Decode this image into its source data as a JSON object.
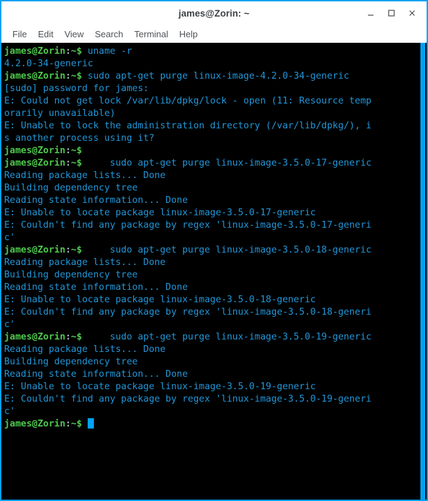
{
  "window": {
    "title": "james@Zorin: ~",
    "border_color": "#00a2f3",
    "buttons": {
      "minimize": "minimize",
      "maximize": "maximize",
      "close": "close"
    }
  },
  "menubar": {
    "items": [
      {
        "label": "File"
      },
      {
        "label": "Edit"
      },
      {
        "label": "View"
      },
      {
        "label": "Search"
      },
      {
        "label": "Terminal"
      },
      {
        "label": "Help"
      }
    ]
  },
  "terminal": {
    "background": "#000000",
    "prompt": {
      "user_host": "james@Zorin",
      "colon": ":",
      "path_sigil": "~$",
      "user_host_color": "#4ec94e",
      "text_color": "#2196d8"
    },
    "cursor": {
      "color": "#00a2f3",
      "shape": "block"
    },
    "lines": [
      {
        "type": "prompt",
        "text": " uname -r"
      },
      {
        "type": "output",
        "text": "4.2.0-34-generic"
      },
      {
        "type": "prompt",
        "text": " sudo apt-get purge linux-image-4.2.0-34-generic"
      },
      {
        "type": "output",
        "text": "[sudo] password for james:"
      },
      {
        "type": "output",
        "text": "E: Could not get lock /var/lib/dpkg/lock - open (11: Resource temp"
      },
      {
        "type": "output",
        "text": "orarily unavailable)"
      },
      {
        "type": "output",
        "text": "E: Unable to lock the administration directory (/var/lib/dpkg/), i"
      },
      {
        "type": "output",
        "text": "s another process using it?"
      },
      {
        "type": "prompt",
        "text": ""
      },
      {
        "type": "prompt",
        "text": "     sudo apt-get purge linux-image-3.5.0-17-generic"
      },
      {
        "type": "output",
        "text": "Reading package lists... Done"
      },
      {
        "type": "output",
        "text": "Building dependency tree"
      },
      {
        "type": "output",
        "text": "Reading state information... Done"
      },
      {
        "type": "output",
        "text": "E: Unable to locate package linux-image-3.5.0-17-generic"
      },
      {
        "type": "output",
        "text": "E: Couldn't find any package by regex 'linux-image-3.5.0-17-generi"
      },
      {
        "type": "output",
        "text": "c'"
      },
      {
        "type": "prompt",
        "text": "     sudo apt-get purge linux-image-3.5.0-18-generic"
      },
      {
        "type": "output",
        "text": "Reading package lists... Done"
      },
      {
        "type": "output",
        "text": "Building dependency tree"
      },
      {
        "type": "output",
        "text": "Reading state information... Done"
      },
      {
        "type": "output",
        "text": "E: Unable to locate package linux-image-3.5.0-18-generic"
      },
      {
        "type": "output",
        "text": "E: Couldn't find any package by regex 'linux-image-3.5.0-18-generi"
      },
      {
        "type": "output",
        "text": "c'"
      },
      {
        "type": "prompt",
        "text": "     sudo apt-get purge linux-image-3.5.0-19-generic"
      },
      {
        "type": "output",
        "text": "Reading package lists... Done"
      },
      {
        "type": "output",
        "text": "Building dependency tree"
      },
      {
        "type": "output",
        "text": "Reading state information... Done"
      },
      {
        "type": "output",
        "text": "E: Unable to locate package linux-image-3.5.0-19-generic"
      },
      {
        "type": "output",
        "text": "E: Couldn't find any package by regex 'linux-image-3.5.0-19-generi"
      },
      {
        "type": "output",
        "text": "c'"
      },
      {
        "type": "cursor",
        "text": " "
      }
    ]
  },
  "scrollbar": {
    "thumb_color": "#00a2f3",
    "thumb_top_pct": 0,
    "thumb_height_pct": 100
  }
}
